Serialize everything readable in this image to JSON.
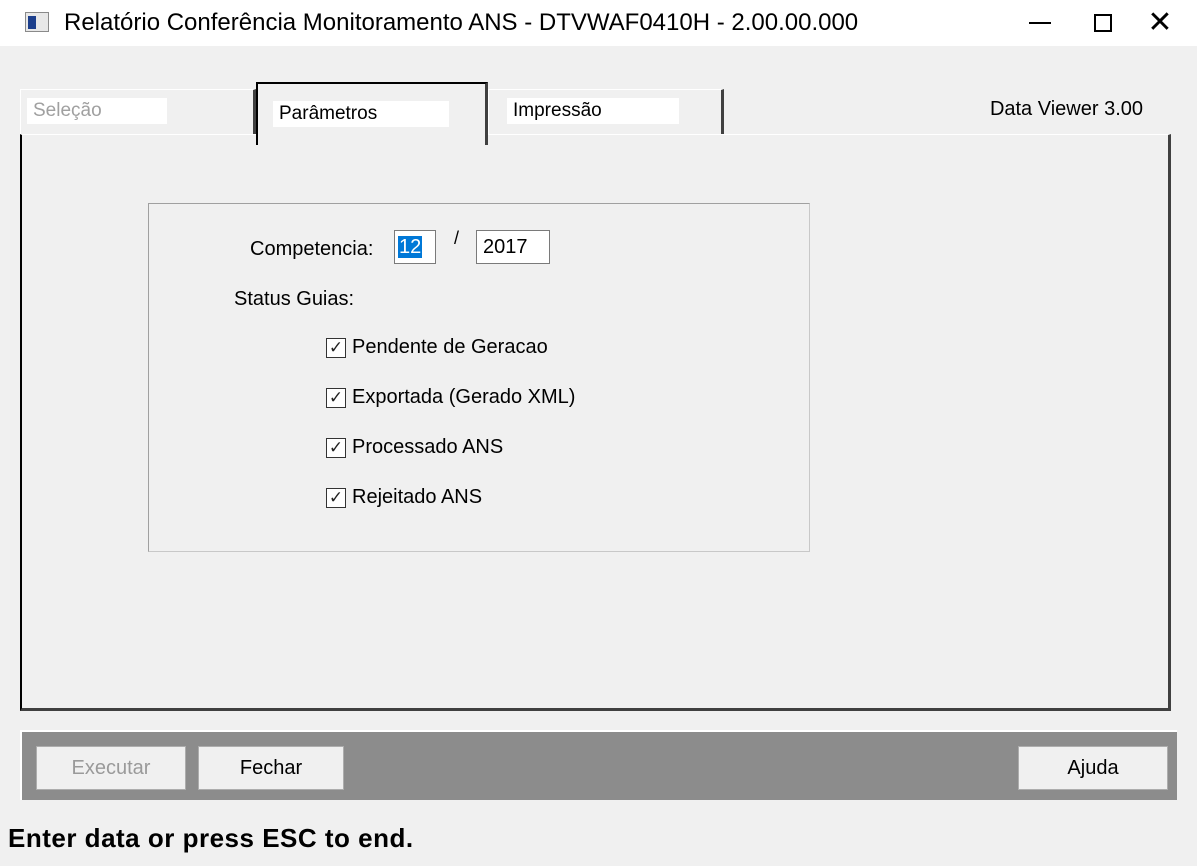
{
  "window": {
    "title": "Relatório Conferência Monitoramento ANS - DTVWAF0410H - 2.00.00.000",
    "icon": "app-window-icon"
  },
  "tabs": [
    {
      "label": "Seleção",
      "state": "disabled"
    },
    {
      "label": "Parâmetros",
      "state": "active"
    },
    {
      "label": "Impressão",
      "state": "normal"
    }
  ],
  "viewer_label": "Data Viewer 3.00",
  "form": {
    "competencia_label": "Competencia:",
    "month_value": "12",
    "separator": "/",
    "year_value": "2017",
    "status_label": "Status Guias:",
    "checkboxes": [
      {
        "label": "Pendente de Geracao",
        "checked": true
      },
      {
        "label": "Exportada (Gerado XML)",
        "checked": true
      },
      {
        "label": "Processado ANS",
        "checked": true
      },
      {
        "label": "Rejeitado ANS",
        "checked": true
      }
    ]
  },
  "buttons": {
    "executar": "Executar",
    "fechar": "Fechar",
    "ajuda": "Ajuda"
  },
  "status_bar": "Enter data or press ESC to end.",
  "colors": {
    "selection": "#0078d7",
    "toolbar": "#8c8c8c"
  }
}
